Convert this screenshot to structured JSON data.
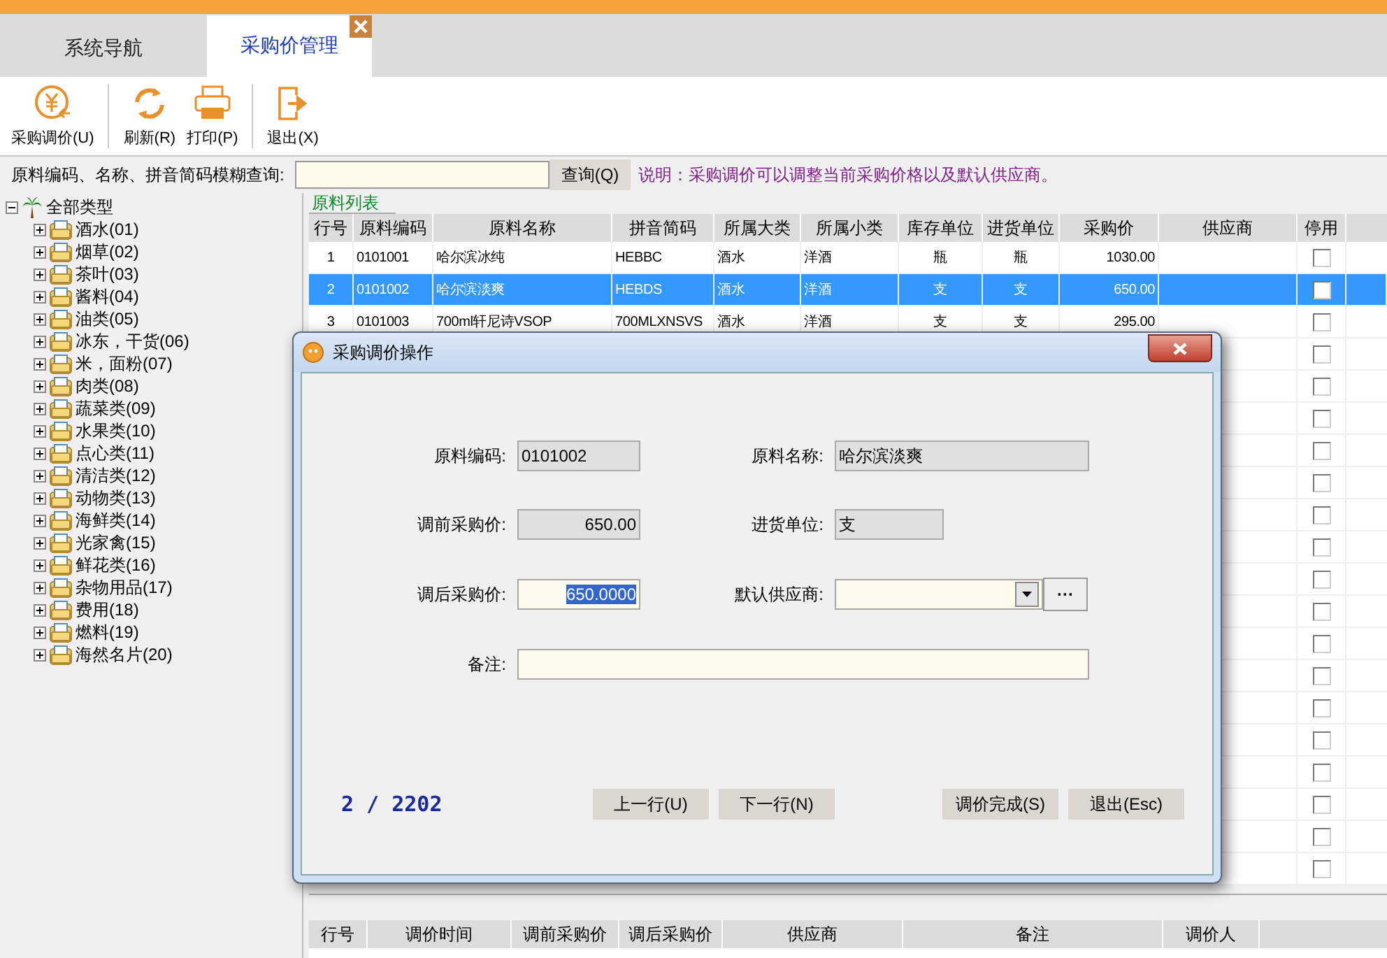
{
  "tabs": [
    {
      "label": "系统导航",
      "selected": false,
      "closable": false
    },
    {
      "label": "采购价管理",
      "selected": true,
      "closable": true
    }
  ],
  "toolbar": [
    {
      "label": "采购调价(U)",
      "kind": "price",
      "separator_after": true
    },
    {
      "label": "刷新(R)",
      "kind": "refresh",
      "separator_after": false
    },
    {
      "label": "打印(P)",
      "kind": "print",
      "separator_after": true
    },
    {
      "label": "退出(X)",
      "kind": "exit",
      "separator_after": false
    }
  ],
  "search": {
    "label": "原料编码、名称、拼音简码模糊查询:",
    "button": "查询(Q)",
    "note": "说明：采购调价可以调整当前采购价格以及默认供应商。"
  },
  "tree": {
    "label": "全部类型",
    "expanded": true,
    "children": [
      {
        "label": "酒水(01)",
        "expanded": false
      },
      {
        "label": "烟草(02)",
        "expanded": false
      },
      {
        "label": "茶叶(03)",
        "expanded": false
      },
      {
        "label": "酱料(04)",
        "expanded": false
      },
      {
        "label": "油类(05)",
        "expanded": false
      },
      {
        "label": "冰东，干货(06)",
        "expanded": false
      },
      {
        "label": "米，面粉(07)",
        "expanded": false
      },
      {
        "label": "肉类(08)",
        "expanded": false
      },
      {
        "label": "蔬菜类(09)",
        "expanded": false
      },
      {
        "label": "水果类(10)",
        "expanded": false
      },
      {
        "label": "点心类(11)",
        "expanded": false
      },
      {
        "label": "清洁类(12)",
        "expanded": false
      },
      {
        "label": "动物类(13)",
        "expanded": false
      },
      {
        "label": "海鲜类(14)",
        "expanded": false
      },
      {
        "label": "光家禽(15)",
        "expanded": false
      },
      {
        "label": "鲜花类(16)",
        "expanded": false
      },
      {
        "label": "杂物用品(17)",
        "expanded": false
      },
      {
        "label": "费用(18)",
        "expanded": false
      },
      {
        "label": "燃料(19)",
        "expanded": false
      },
      {
        "label": "海然名片(20)",
        "expanded": false
      }
    ]
  },
  "material_list": {
    "title": "原料列表",
    "columns": [
      "行号",
      "原料编码",
      "原料名称",
      "拼音简码",
      "所属大类",
      "所属小类",
      "库存单位",
      "进货单位",
      "采购价",
      "供应商",
      "停用"
    ],
    "rows": [
      {
        "no": "1",
        "code": "0101001",
        "name": "哈尔滨冰纯",
        "pinyin": "HEBBC",
        "category": "酒水",
        "subcategory": "洋酒",
        "stock_unit": "瓶",
        "purchase_unit": "瓶",
        "price": "1030.00",
        "stopped": false,
        "selected": false
      },
      {
        "no": "2",
        "code": "0101002",
        "name": "哈尔滨淡爽",
        "pinyin": "HEBDS",
        "category": "酒水",
        "subcategory": "洋酒",
        "stock_unit": "支",
        "purchase_unit": "支",
        "price": "650.00",
        "stopped": false,
        "selected": true
      },
      {
        "no": "3",
        "code": "0101003",
        "name": "700ml轩尼诗VSOP",
        "pinyin": "700MLXNSVS",
        "category": "酒水",
        "subcategory": "洋酒",
        "stock_unit": "支",
        "purchase_unit": "支",
        "price": "295.00",
        "stopped": false,
        "selected": false
      },
      {
        "stopped": false,
        "selected": false
      },
      {
        "stopped": false,
        "selected": false
      },
      {
        "stopped": false,
        "selected": false
      },
      {
        "stopped": false,
        "selected": false
      },
      {
        "stopped": false,
        "selected": false
      },
      {
        "stopped": false,
        "selected": false
      },
      {
        "stopped": false,
        "selected": false
      },
      {
        "stopped": false,
        "selected": false
      },
      {
        "stopped": false,
        "selected": false
      },
      {
        "stopped": false,
        "selected": false
      },
      {
        "stopped": false,
        "selected": false
      },
      {
        "stopped": false,
        "selected": false
      },
      {
        "stopped": false,
        "selected": false
      },
      {
        "stopped": false,
        "selected": false
      },
      {
        "stopped": false,
        "selected": false
      },
      {
        "stopped": false,
        "selected": false
      },
      {
        "stopped": false,
        "selected": false
      }
    ]
  },
  "history": {
    "columns": [
      "行号",
      "调价时间",
      "调前采购价",
      "调后采购价",
      "供应商",
      "备注",
      "调价人"
    ]
  },
  "dialog": {
    "title": "采购调价操作",
    "code_label": "原料编码:",
    "code": "0101002",
    "name_label": "原料名称:",
    "name": "哈尔滨淡爽",
    "old_price_label": "调前采购价:",
    "old_price": "650.00",
    "unit_label": "进货单位:",
    "unit": "支",
    "new_price_label": "调后采购价:",
    "new_price": "650.0000",
    "new_price_selected": true,
    "supplier_label": "默认供应商:",
    "browse_button": "···",
    "memo_label": "备注:",
    "counter": "2 / 2202",
    "buttons": [
      "上一行(U)",
      "下一行(N)",
      "调价完成(S)",
      "退出(Esc)"
    ]
  }
}
